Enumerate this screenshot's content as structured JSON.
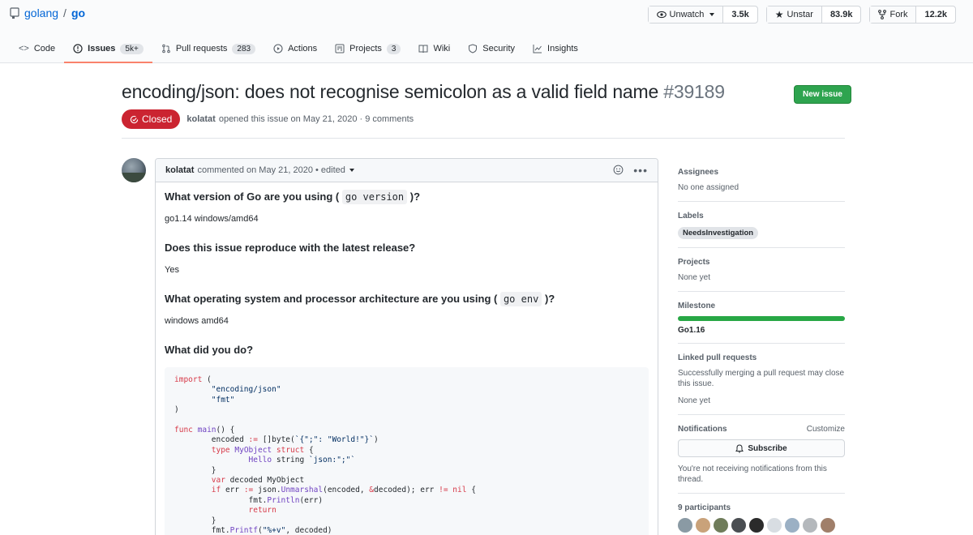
{
  "repo": {
    "owner": "golang",
    "sep": "/",
    "name": "go"
  },
  "actions": {
    "watch": {
      "label": "Unwatch",
      "count": "3.5k"
    },
    "star": {
      "label": "Unstar",
      "count": "83.9k"
    },
    "fork": {
      "label": "Fork",
      "count": "12.2k"
    }
  },
  "tabs": [
    {
      "label": "Code",
      "counter": ""
    },
    {
      "label": "Issues",
      "counter": "5k+"
    },
    {
      "label": "Pull requests",
      "counter": "283"
    },
    {
      "label": "Actions",
      "counter": ""
    },
    {
      "label": "Projects",
      "counter": "3"
    },
    {
      "label": "Wiki",
      "counter": ""
    },
    {
      "label": "Security",
      "counter": ""
    },
    {
      "label": "Insights",
      "counter": ""
    }
  ],
  "issue": {
    "title": "encoding/json: does not recognise semicolon as a valid field name",
    "number": "#39189",
    "status": "Closed",
    "author": "kolatat",
    "opened_text": "opened this issue on May 21, 2020 · 9 comments",
    "new_issue_label": "New issue"
  },
  "comment": {
    "author": "kolatat",
    "meta": "commented on May 21, 2020 • edited",
    "q1_prefix": "What version of Go are you using (",
    "q1_code": "go version",
    "q1_suffix": ")?",
    "a1": "go1.14 windows/amd64",
    "q2": "Does this issue reproduce with the latest release?",
    "a2": "Yes",
    "q3_prefix": "What operating system and processor architecture are you using (",
    "q3_code": "go env",
    "q3_suffix": ")?",
    "a3": "windows amd64",
    "q4": "What did you do?"
  },
  "sidebar": {
    "assignees_label": "Assignees",
    "assignees_value": "No one assigned",
    "labels_label": "Labels",
    "label_chip": "NeedsInvestigation",
    "projects_label": "Projects",
    "projects_value": "None yet",
    "milestone_label": "Milestone",
    "milestone_name": "Go1.16",
    "milestone_progress": 1.0,
    "linked_label": "Linked pull requests",
    "linked_text": "Successfully merging a pull request may close this issue.",
    "linked_value": "None yet",
    "notifications_label": "Notifications",
    "customize_label": "Customize",
    "subscribe_label": "Subscribe",
    "notifications_text": "You're not receiving notifications from this thread.",
    "participants_label": "9 participants"
  },
  "colors": {
    "closed": "#cb2431",
    "new_issue": "#2ea44f",
    "tab_active": "#f9826c",
    "milestone": "#28a745"
  }
}
